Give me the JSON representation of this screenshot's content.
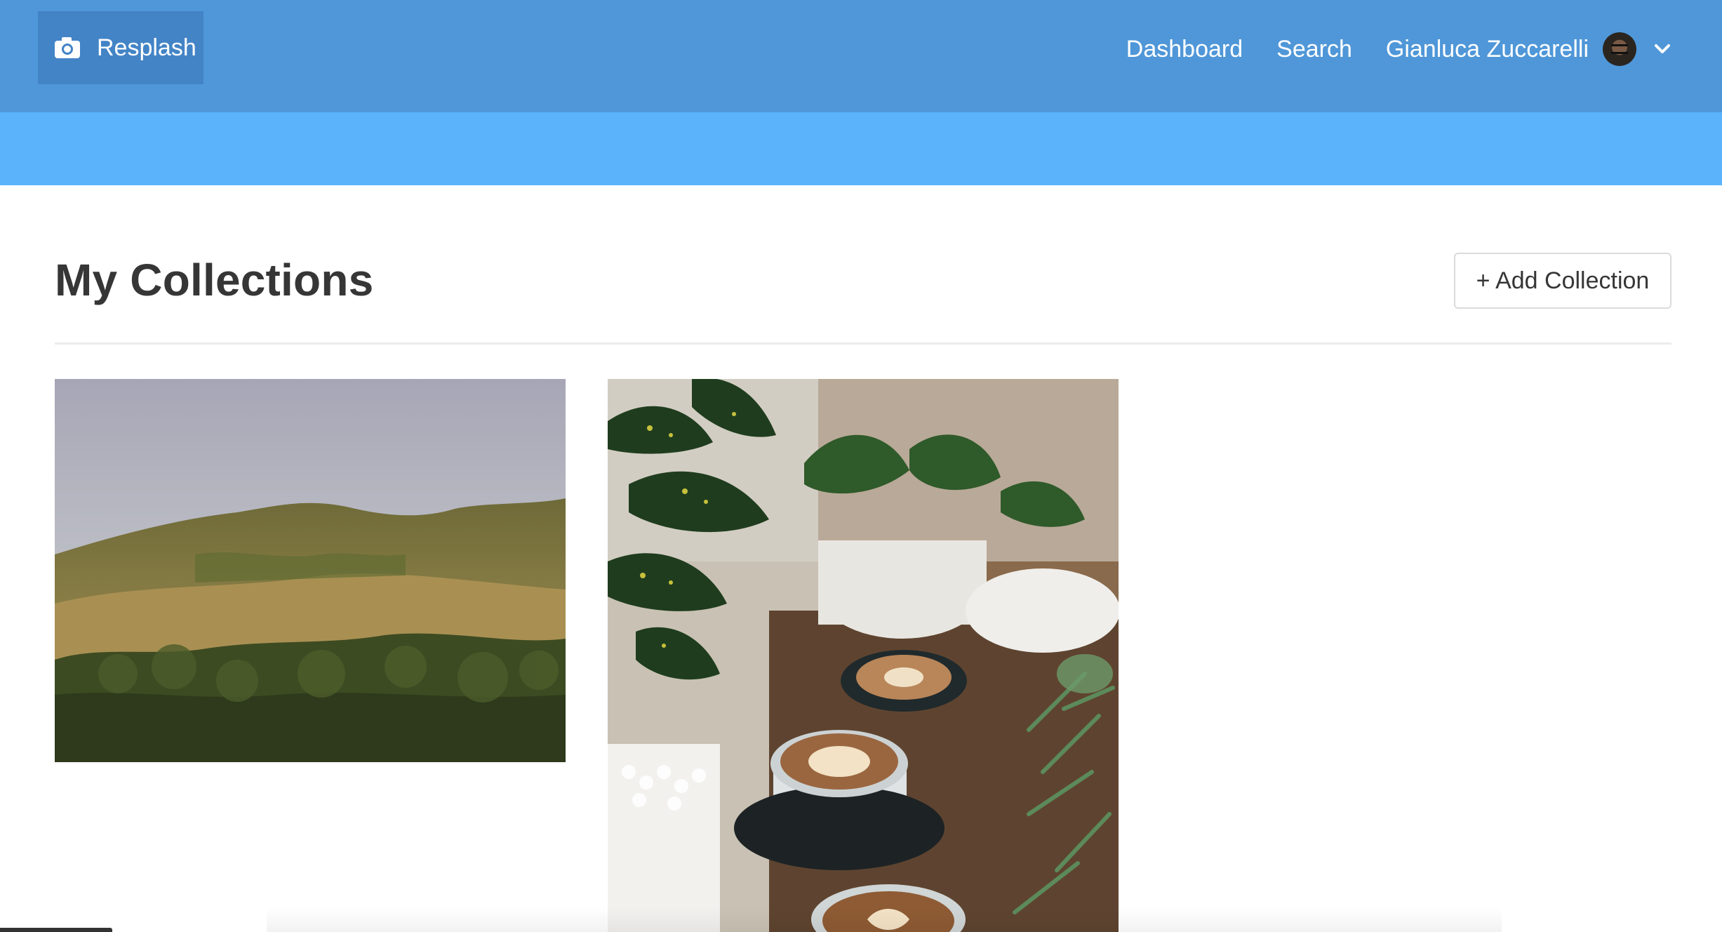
{
  "brand": {
    "name": "Resplash",
    "icon": "camera-icon"
  },
  "nav": {
    "dashboard": "Dashboard",
    "search": "Search",
    "user_name": "Gianluca Zuccarelli",
    "dropdown_icon": "chevron-down-icon"
  },
  "page": {
    "title": "My Collections",
    "add_button": "+ Add Collection"
  },
  "collections": [
    {
      "thumbnail": "rolling green and golden hills with trees under a pale sky"
    },
    {
      "thumbnail": "potted plants and latte art coffee cups on a wooden table"
    }
  ],
  "colors": {
    "navbar": "#4f97d8",
    "brand_bg": "#4384c6",
    "hero": "#5ab3fb",
    "text": "#363636"
  }
}
